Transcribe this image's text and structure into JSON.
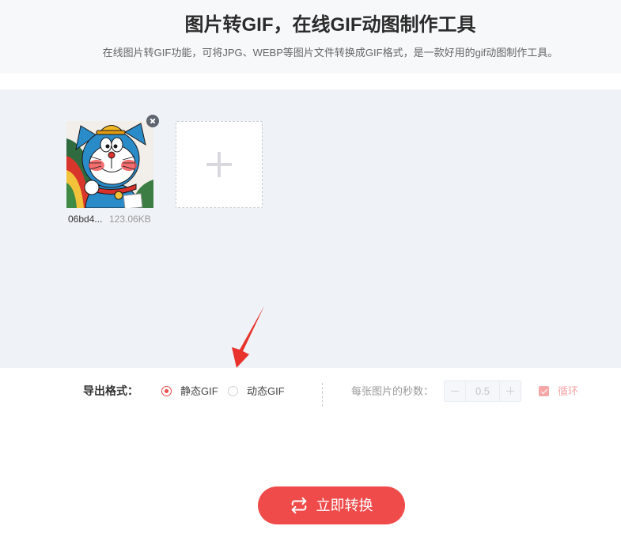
{
  "header": {
    "title": "图片转GIF，在线GIF动图制作工具",
    "subtitle": "在线图片转GIF功能，可将JPG、WEBP等图片文件转换成GIF格式，是一款好用的gif动图制作工具。"
  },
  "upload": {
    "files": [
      {
        "name": "06bd4...",
        "size": "123.06KB",
        "thumbnail": "doraemon-cartoon-image",
        "remove_icon": "close-icon"
      }
    ],
    "add_icon": "plus-icon"
  },
  "options": {
    "format_label": "导出格式：",
    "formats": [
      {
        "label": "静态GIF",
        "selected": true
      },
      {
        "label": "动态GIF",
        "selected": false
      }
    ],
    "seconds": {
      "label": "每张图片的秒数：",
      "value": "0.5",
      "disabled": true,
      "decrement_icon": "minus-icon",
      "increment_icon": "plus-icon"
    },
    "loop": {
      "label": "循环",
      "checked": true,
      "disabled": true
    }
  },
  "action": {
    "convert_label": "立即转换",
    "convert_icon": "repeat-icon"
  },
  "colors": {
    "accent": "#f04b4b",
    "accent_disabled": "#f5a6a6",
    "header_bg": "#f7f8fa",
    "upload_bg": "#eff2f7",
    "annotation": "#e8322b"
  }
}
